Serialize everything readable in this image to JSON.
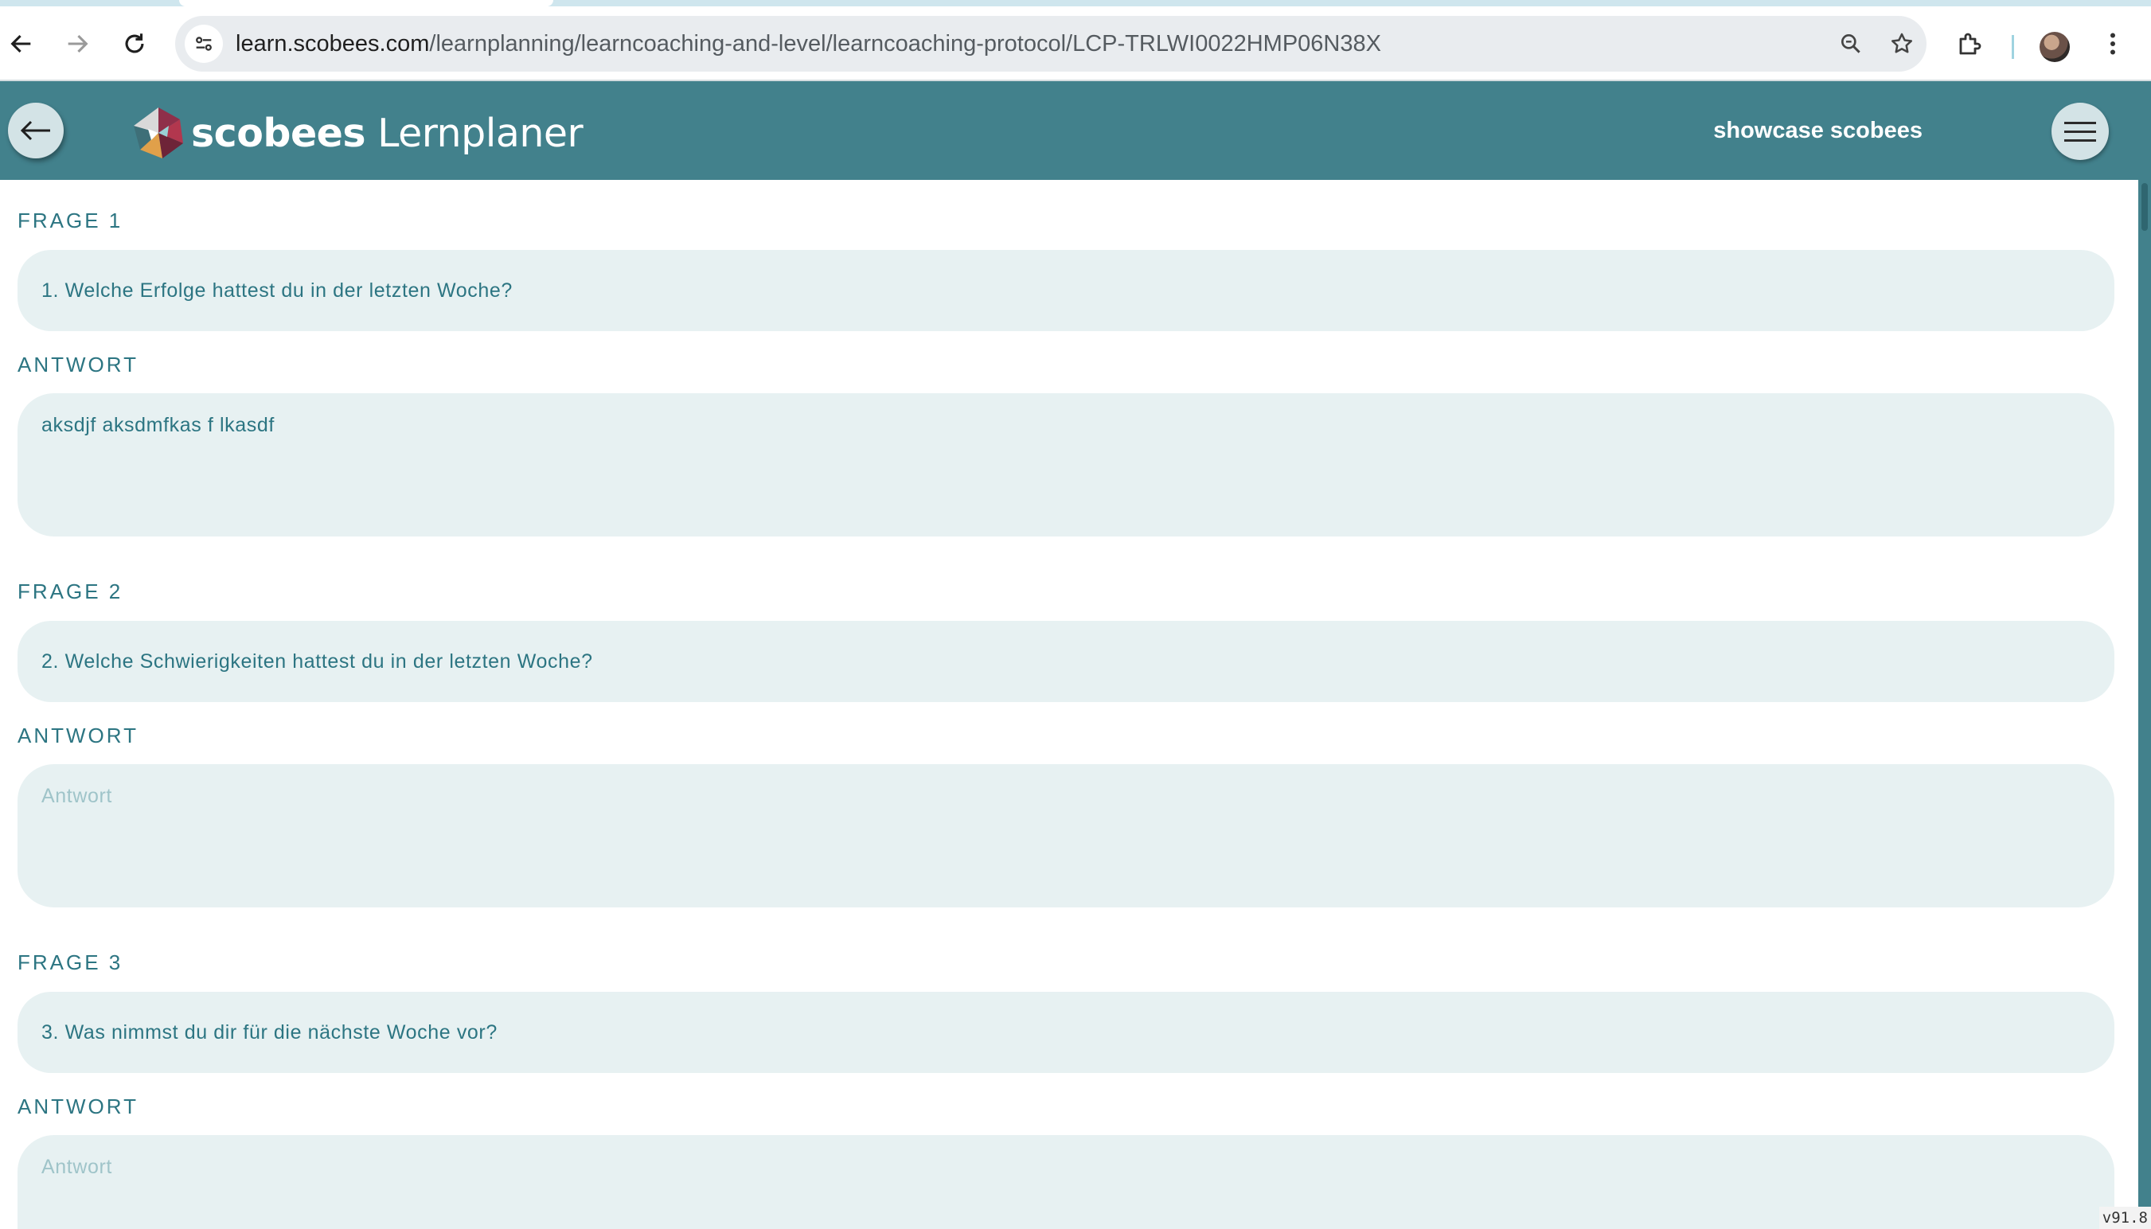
{
  "browser": {
    "url_host": "learn.scobees.com",
    "url_path": "/learnplanning/learncoaching-and-level/learncoaching-protocol/LCP-TRLWI0022HMP06N38X"
  },
  "header": {
    "logo_bold": "scobees",
    "logo_light": "Lernplaner",
    "user_name": "showcase scobees"
  },
  "questions": [
    {
      "label": "FRAGE 1",
      "text": "1. Welche Erfolge hattest du in der letzten Woche?",
      "answer_label": "ANTWORT",
      "answer_value": "aksdjf aksdmfkas f lkasdf",
      "answer_placeholder": "Antwort"
    },
    {
      "label": "FRAGE 2",
      "text": "2. Welche Schwierigkeiten hattest du in der letzten Woche?",
      "answer_label": "ANTWORT",
      "answer_value": "",
      "answer_placeholder": "Antwort"
    },
    {
      "label": "FRAGE 3",
      "text": "3. Was nimmst du dir für die nächste Woche vor?",
      "answer_label": "ANTWORT",
      "answer_value": "",
      "answer_placeholder": "Antwort"
    }
  ],
  "footer": {
    "version": "v91.8"
  },
  "colors": {
    "header_bg": "#42818c",
    "field_bg": "#e7f1f2",
    "accent_text": "#2c7582"
  }
}
